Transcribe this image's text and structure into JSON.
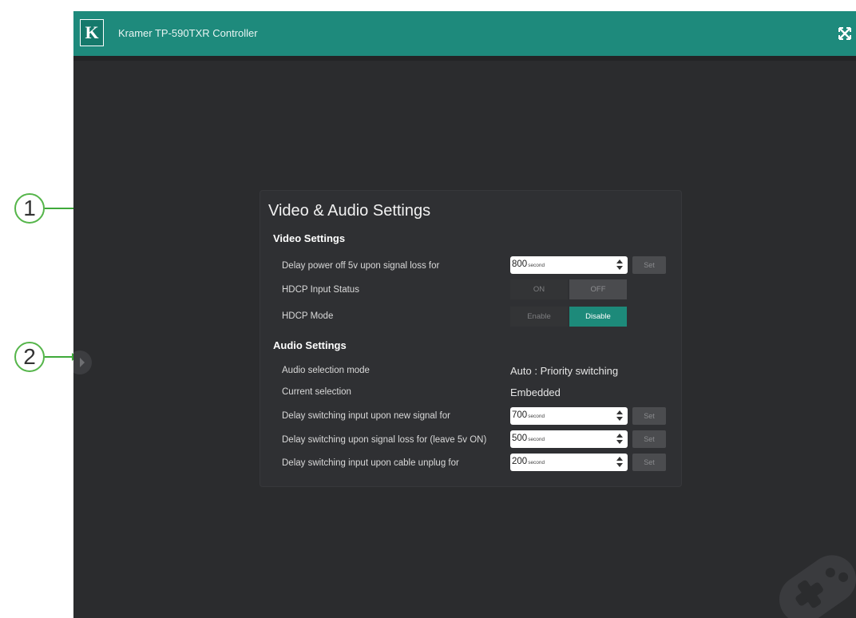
{
  "window": {
    "title": "Kramer TP-590TXR Controller",
    "logo_letter": "K"
  },
  "icons": {
    "fullscreen": "fullscreen-icon",
    "expand_sidebar": "chevron-right-icon"
  },
  "panel": {
    "title": "Video & Audio Settings",
    "video_section": "Video Settings",
    "audio_section": "Audio Settings",
    "set_label": "Set",
    "unit": "second",
    "video": {
      "delay_power_off": {
        "label": "Delay power off 5v upon signal loss for",
        "value": "800"
      },
      "hdcp_input_status": {
        "label": "HDCP Input Status",
        "on": "ON",
        "off": "OFF",
        "selected": "OFF"
      },
      "hdcp_mode": {
        "label": "HDCP Mode",
        "enable": "Enable",
        "disable": "Disable",
        "selected": "Disable"
      }
    },
    "audio": {
      "selection_mode": {
        "label": "Audio selection mode",
        "value": "Auto : Priority switching"
      },
      "current_selection": {
        "label": "Current selection",
        "value": "Embedded"
      },
      "delay_new_signal": {
        "label": "Delay switching input upon new signal for",
        "value": "700"
      },
      "delay_signal_loss": {
        "label": "Delay switching upon signal loss for (leave 5v ON)",
        "value": "500"
      },
      "delay_cable_unplug": {
        "label": "Delay switching input upon cable unplug for",
        "value": "200"
      }
    }
  },
  "callouts": [
    "1",
    "2"
  ],
  "colors": {
    "accent": "#1d8a7a",
    "background": "#2b2c2e",
    "callout_green": "#3fa93a"
  }
}
